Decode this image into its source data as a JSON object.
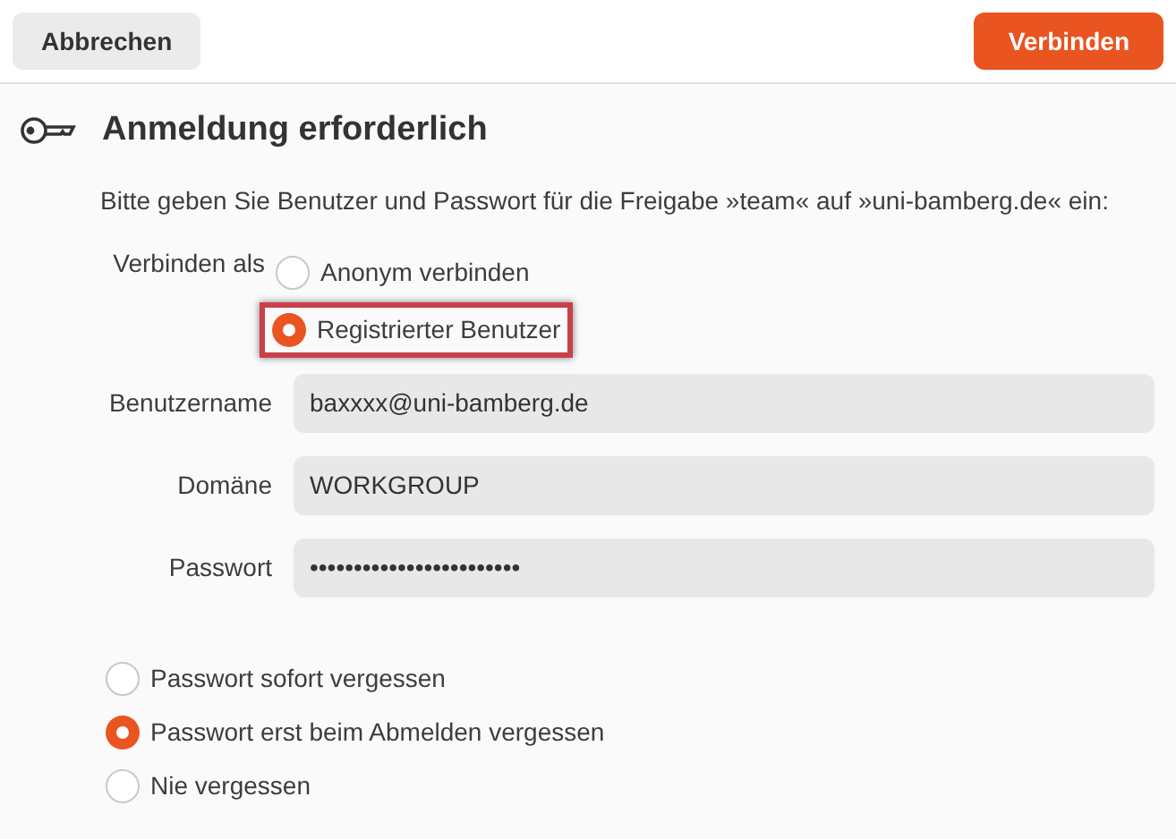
{
  "header": {
    "cancel": "Abbrechen",
    "connect": "Verbinden"
  },
  "title": "Anmeldung erforderlich",
  "description": "Bitte geben Sie Benutzer und Passwort für die Freigabe »team« auf »uni-bamberg.de« ein:",
  "connect_as": {
    "label": "Verbinden als",
    "options": [
      {
        "label": "Anonym verbinden",
        "selected": false,
        "highlighted": false
      },
      {
        "label": "Registrierter Benutzer",
        "selected": true,
        "highlighted": true
      }
    ]
  },
  "fields": [
    {
      "label": "Benutzername",
      "value": "baxxxx@uni-bamberg.de"
    },
    {
      "label": "Domäne",
      "value": "WORKGROUP"
    },
    {
      "label": "Passwort",
      "value": "••••••••••••••••••••••••"
    }
  ],
  "remember": [
    {
      "label": "Passwort sofort vergessen",
      "selected": false
    },
    {
      "label": "Passwort erst beim Abmelden vergessen",
      "selected": true
    },
    {
      "label": "Nie vergessen",
      "selected": false
    }
  ]
}
